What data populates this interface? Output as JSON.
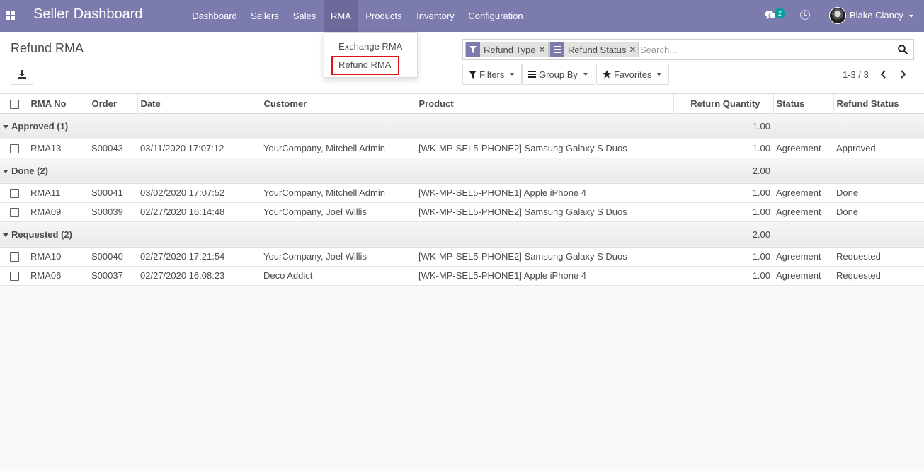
{
  "navbar": {
    "brand": "Seller Dashboard",
    "menu": [
      "Dashboard",
      "Sellers",
      "Sales",
      "RMA",
      "Products",
      "Inventory",
      "Configuration"
    ],
    "active_menu": "RMA",
    "chat_count": "2",
    "user_name": "Blake Clancy",
    "bg_color": "#7c7bad"
  },
  "control_panel": {
    "breadcrumb": "Refund RMA",
    "search": {
      "facets": [
        {
          "label": "Refund Type",
          "icon": "filter-icon"
        },
        {
          "label": "Refund Status",
          "icon": "group-by-icon"
        }
      ],
      "placeholder": "Search..."
    },
    "buttons": {
      "filters": "Filters",
      "group_by": "Group By",
      "favorites": "Favorites"
    },
    "pager": "1-3 / 3"
  },
  "rma_dropdown": {
    "items": [
      "Exchange RMA",
      "Refund RMA"
    ],
    "highlighted": "Refund RMA"
  },
  "table": {
    "columns": [
      "RMA No",
      "Order",
      "Date",
      "Customer",
      "Product",
      "Return Quantity",
      "Status",
      "Refund Status"
    ],
    "groups": [
      {
        "label": "Approved (1)",
        "total": "1.00",
        "rows": [
          {
            "rma": "RMA13",
            "order": "S00043",
            "date": "03/11/2020 17:07:12",
            "customer": "YourCompany, Mitchell Admin",
            "product": "[WK-MP-SEL5-PHONE2] Samsung Galaxy S Duos",
            "qty": "1.00",
            "status": "Agreement",
            "refund_status": "Approved"
          }
        ]
      },
      {
        "label": "Done (2)",
        "total": "2.00",
        "rows": [
          {
            "rma": "RMA11",
            "order": "S00041",
            "date": "03/02/2020 17:07:52",
            "customer": "YourCompany, Mitchell Admin",
            "product": "[WK-MP-SEL5-PHONE1] Apple iPhone 4",
            "qty": "1.00",
            "status": "Agreement",
            "refund_status": "Done"
          },
          {
            "rma": "RMA09",
            "order": "S00039",
            "date": "02/27/2020 16:14:48",
            "customer": "YourCompany, Joel Willis",
            "product": "[WK-MP-SEL5-PHONE2] Samsung Galaxy S Duos",
            "qty": "1.00",
            "status": "Agreement",
            "refund_status": "Done"
          }
        ]
      },
      {
        "label": "Requested (2)",
        "total": "2.00",
        "rows": [
          {
            "rma": "RMA10",
            "order": "S00040",
            "date": "02/27/2020 17:21:54",
            "customer": "YourCompany, Joel Willis",
            "product": "[WK-MP-SEL5-PHONE2] Samsung Galaxy S Duos",
            "qty": "1.00",
            "status": "Agreement",
            "refund_status": "Requested"
          },
          {
            "rma": "RMA06",
            "order": "S00037",
            "date": "02/27/2020 16:08:23",
            "customer": "Deco Addict",
            "product": "[WK-MP-SEL5-PHONE1] Apple iPhone 4",
            "qty": "1.00",
            "status": "Agreement",
            "refund_status": "Requested"
          }
        ]
      }
    ]
  }
}
